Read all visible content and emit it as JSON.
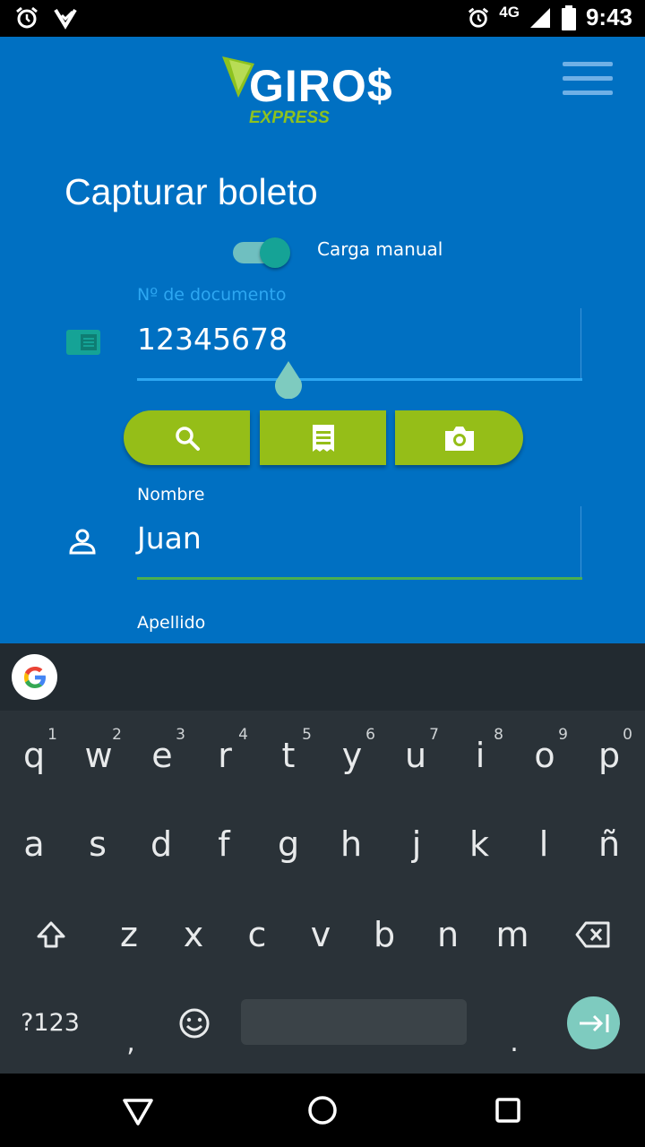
{
  "status_bar": {
    "time": "9:43",
    "network": "4G",
    "icons": [
      "alarm-icon",
      "notification-check-icon",
      "signal-icon",
      "battery-icon"
    ]
  },
  "header": {
    "logo_main": "GIRO$",
    "logo_sub": "EXPRESS",
    "menu_icon": "hamburger-menu-icon"
  },
  "page": {
    "title": "Capturar boleto",
    "manual_toggle": {
      "label": "Carga manual",
      "on": true
    }
  },
  "form": {
    "document": {
      "label": "Nº de documento",
      "value": "12345678",
      "icon": "id-card-icon"
    },
    "actions": [
      {
        "name": "search",
        "icon": "search-icon"
      },
      {
        "name": "receipt",
        "icon": "receipt-icon"
      },
      {
        "name": "camera",
        "icon": "camera-icon"
      }
    ],
    "name": {
      "label": "Nombre",
      "value": "Juan",
      "icon": "person-icon"
    },
    "surname": {
      "label": "Apellido"
    }
  },
  "keyboard": {
    "row1": [
      {
        "k": "q",
        "h": "1"
      },
      {
        "k": "w",
        "h": "2"
      },
      {
        "k": "e",
        "h": "3"
      },
      {
        "k": "r",
        "h": "4"
      },
      {
        "k": "t",
        "h": "5"
      },
      {
        "k": "y",
        "h": "6"
      },
      {
        "k": "u",
        "h": "7"
      },
      {
        "k": "i",
        "h": "8"
      },
      {
        "k": "o",
        "h": "9"
      },
      {
        "k": "p",
        "h": "0"
      }
    ],
    "row2": [
      "a",
      "s",
      "d",
      "f",
      "g",
      "h",
      "j",
      "k",
      "l",
      "ñ"
    ],
    "row3": [
      "z",
      "x",
      "c",
      "v",
      "b",
      "n",
      "m"
    ],
    "symbols": "?123",
    "comma": ",",
    "period": "."
  },
  "colors": {
    "app_background": "#0070c2",
    "accent_green": "#95be18",
    "toggle_teal": "#15a396",
    "focus_blue": "#2da7f2",
    "keyboard_bg": "#2a3238"
  }
}
